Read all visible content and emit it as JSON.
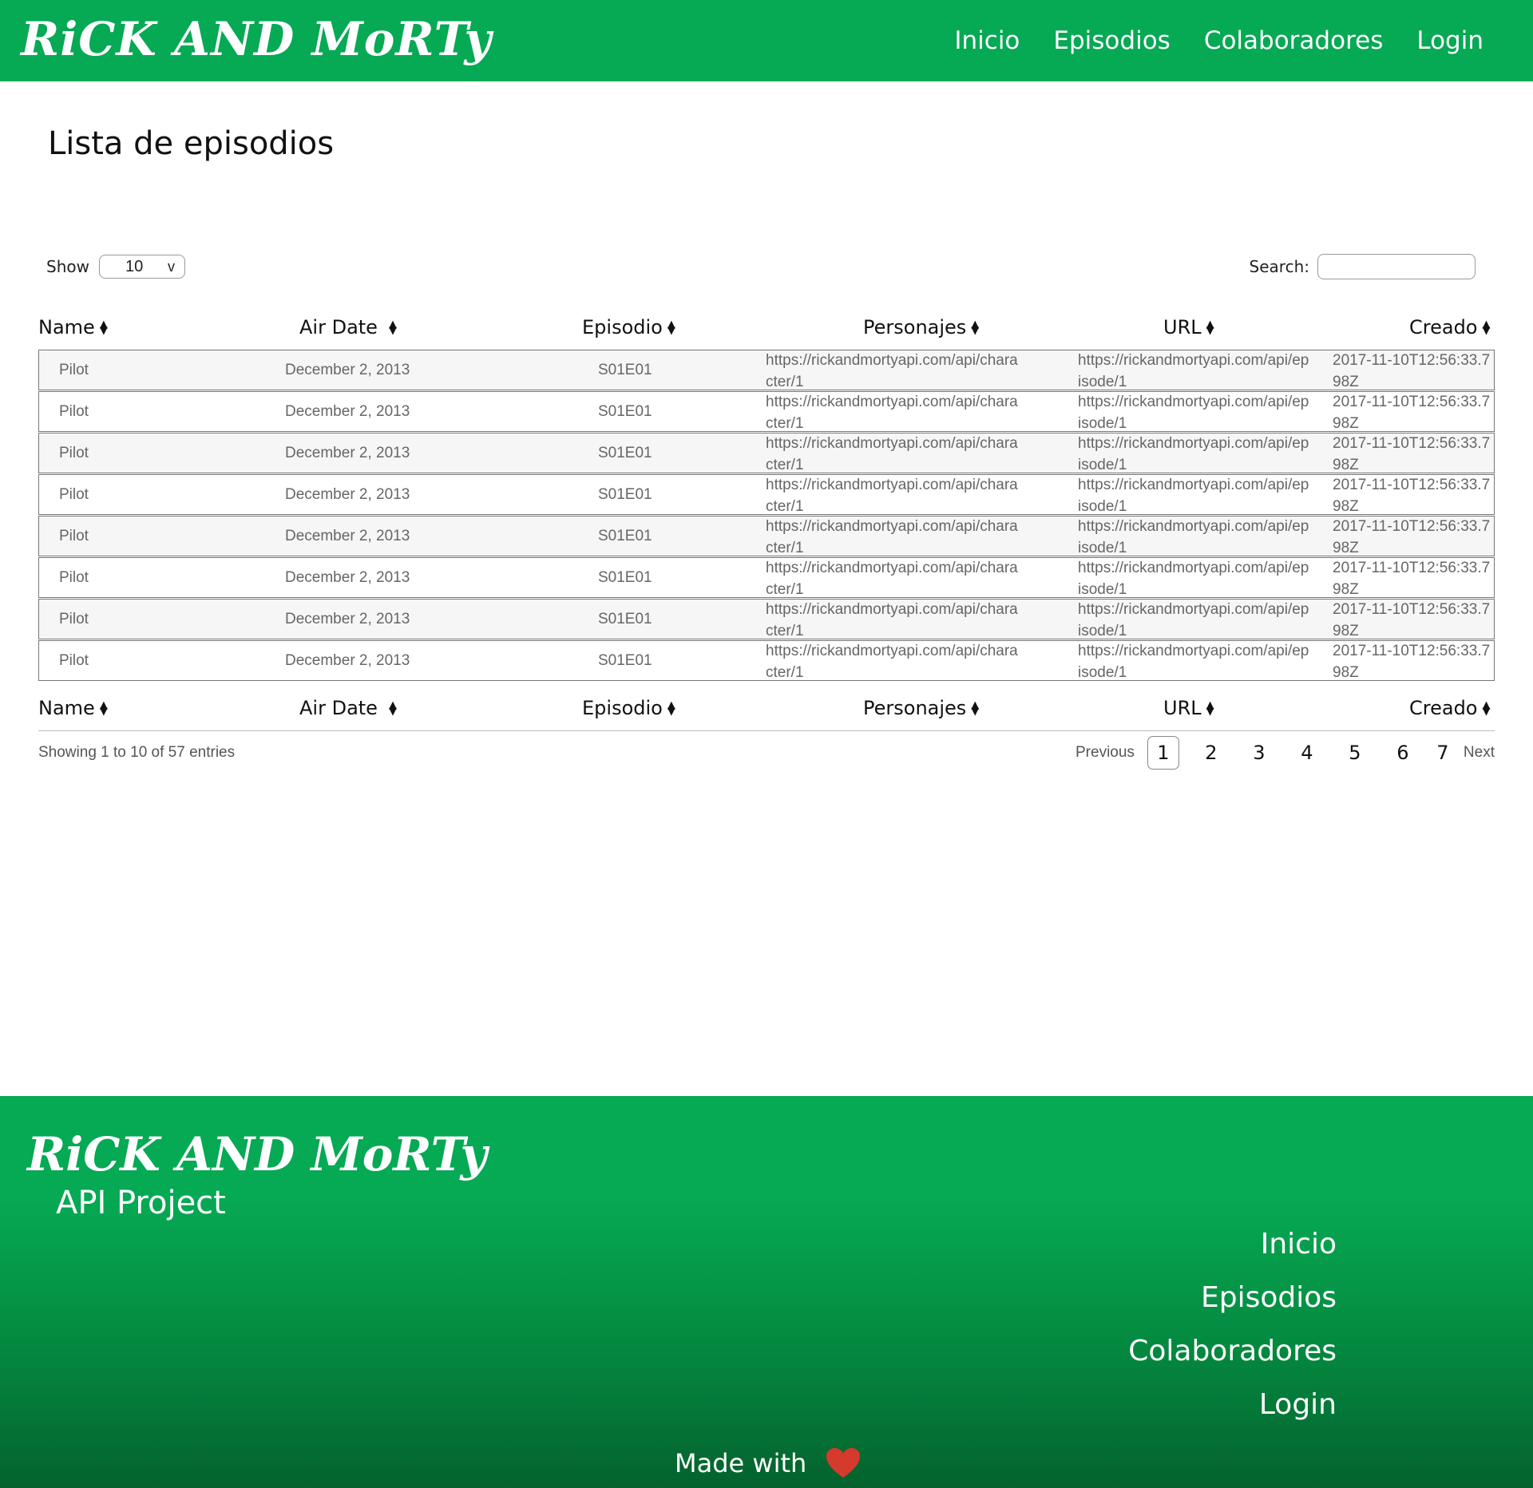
{
  "header": {
    "logo": "RiCK AND MoRTy",
    "nav": [
      "Inicio",
      "Episodios",
      "Colaboradores",
      "Login"
    ]
  },
  "main": {
    "title": "Lista de episodios",
    "show_label": "Show",
    "show_value": "10",
    "show_caret": "v",
    "search_label": "Search:",
    "search_value": "",
    "columns": [
      "Name",
      "Air Date",
      "Episodio",
      "Personajes",
      "URL",
      "Creado"
    ],
    "rows": [
      {
        "name": "Pilot",
        "air_date": "December 2, 2013",
        "episode": "S01E01",
        "characters": "https://rickandmortyapi.com/api/character/1",
        "url": "https://rickandmortyapi.com/api/episode/1",
        "created": "2017-11-10T12:56:33.798Z"
      },
      {
        "name": "Pilot",
        "air_date": "December 2, 2013",
        "episode": "S01E01",
        "characters": "https://rickandmortyapi.com/api/character/1",
        "url": "https://rickandmortyapi.com/api/episode/1",
        "created": "2017-11-10T12:56:33.798Z"
      },
      {
        "name": "Pilot",
        "air_date": "December 2, 2013",
        "episode": "S01E01",
        "characters": "https://rickandmortyapi.com/api/character/1",
        "url": "https://rickandmortyapi.com/api/episode/1",
        "created": "2017-11-10T12:56:33.798Z"
      },
      {
        "name": "Pilot",
        "air_date": "December 2, 2013",
        "episode": "S01E01",
        "characters": "https://rickandmortyapi.com/api/character/1",
        "url": "https://rickandmortyapi.com/api/episode/1",
        "created": "2017-11-10T12:56:33.798Z"
      },
      {
        "name": "Pilot",
        "air_date": "December 2, 2013",
        "episode": "S01E01",
        "characters": "https://rickandmortyapi.com/api/character/1",
        "url": "https://rickandmortyapi.com/api/episode/1",
        "created": "2017-11-10T12:56:33.798Z"
      },
      {
        "name": "Pilot",
        "air_date": "December 2, 2013",
        "episode": "S01E01",
        "characters": "https://rickandmortyapi.com/api/character/1",
        "url": "https://rickandmortyapi.com/api/episode/1",
        "created": "2017-11-10T12:56:33.798Z"
      },
      {
        "name": "Pilot",
        "air_date": "December 2, 2013",
        "episode": "S01E01",
        "characters": "https://rickandmortyapi.com/api/character/1",
        "url": "https://rickandmortyapi.com/api/episode/1",
        "created": "2017-11-10T12:56:33.798Z"
      },
      {
        "name": "Pilot",
        "air_date": "December 2, 2013",
        "episode": "S01E01",
        "characters": "https://rickandmortyapi.com/api/character/1",
        "url": "https://rickandmortyapi.com/api/episode/1",
        "created": "2017-11-10T12:56:33.798Z"
      }
    ],
    "info": "Showing 1 to 10 of 57 entries",
    "pagination": {
      "previous": "Previous",
      "pages": [
        "1",
        "2",
        "3",
        "4",
        "5",
        "6",
        "7"
      ],
      "current": "1",
      "next": "Next"
    }
  },
  "footer": {
    "logo": "RiCK AND MoRTy",
    "subtitle": "API Project",
    "nav": [
      "Inicio",
      "Episodios",
      "Colaboradores",
      "Login"
    ],
    "made_with": "Made with",
    "heart_icon": "heart-icon"
  },
  "colors": {
    "brand_green": "#06a954",
    "footer_dark_green": "#04622d",
    "heart_red": "#d63a2c",
    "row_stripe": "#f6f6f6"
  }
}
